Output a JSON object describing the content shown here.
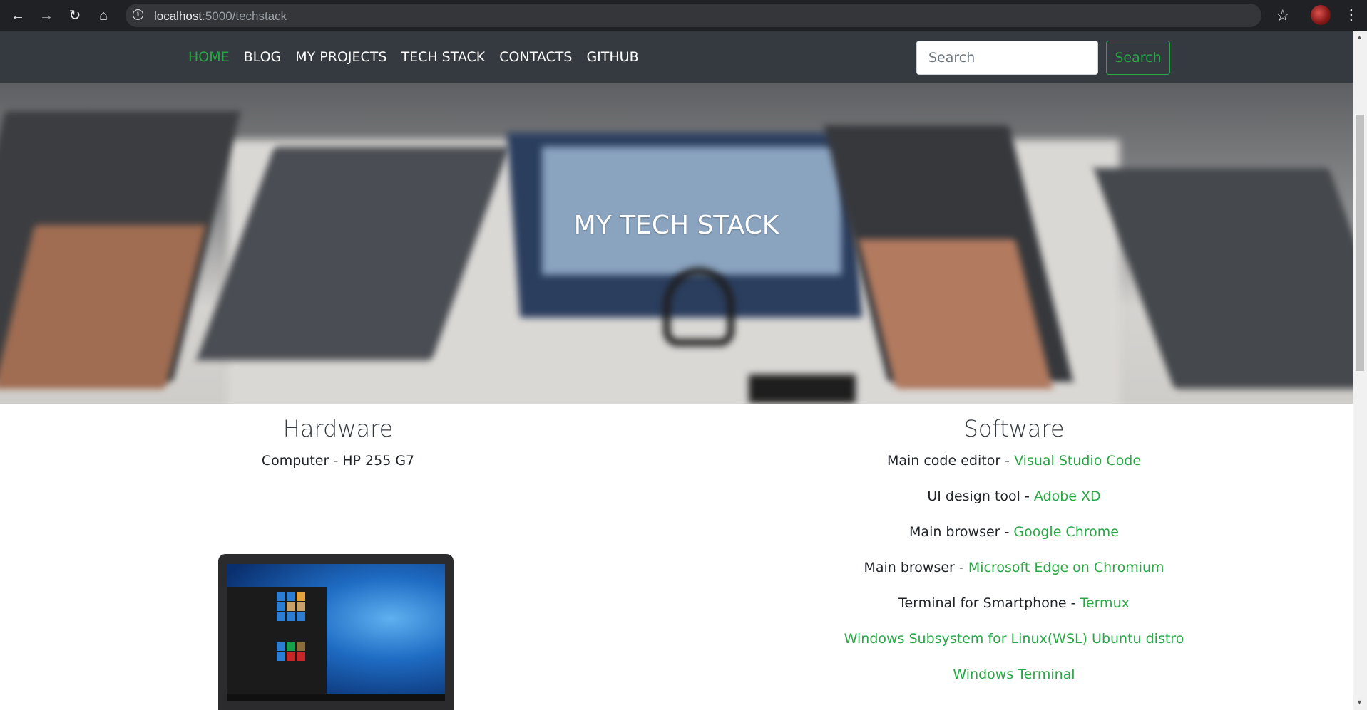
{
  "browser": {
    "url_host": "localhost",
    "url_path": ":5000/techstack",
    "back_icon": "arrow-left-icon",
    "forward_icon": "arrow-right-icon",
    "reload_icon": "reload-icon",
    "home_icon": "home-icon",
    "star_icon": "star-icon"
  },
  "navbar": {
    "links": [
      {
        "label": "HOME",
        "active": true
      },
      {
        "label": "BLOG"
      },
      {
        "label": "MY PROJECTS"
      },
      {
        "label": "TECH STACK"
      },
      {
        "label": "CONTACTS"
      },
      {
        "label": "GITHUB"
      }
    ],
    "search_placeholder": "Search",
    "search_button": "Search",
    "accent_color": "#28a745",
    "background": "#343a40"
  },
  "hero": {
    "title": "MY TECH STACK"
  },
  "hardware": {
    "title": "Hardware",
    "items": [
      {
        "label": "Computer",
        "value": "HP 255 G7"
      }
    ]
  },
  "software": {
    "title": "Software",
    "items": [
      {
        "label": "Main code editor",
        "link": "Visual Studio Code"
      },
      {
        "label": "UI design tool",
        "link": "Adobe XD"
      },
      {
        "label": "Main browser",
        "link": "Google Chrome"
      },
      {
        "label": "Main browser",
        "link": "Microsoft Edge on Chromium"
      },
      {
        "label": "Terminal for Smartphone",
        "link": "Termux"
      },
      {
        "label": "",
        "link": "Windows Subsystem for Linux(WSL) Ubuntu distro"
      },
      {
        "label": "",
        "link": "Windows Terminal"
      }
    ]
  }
}
